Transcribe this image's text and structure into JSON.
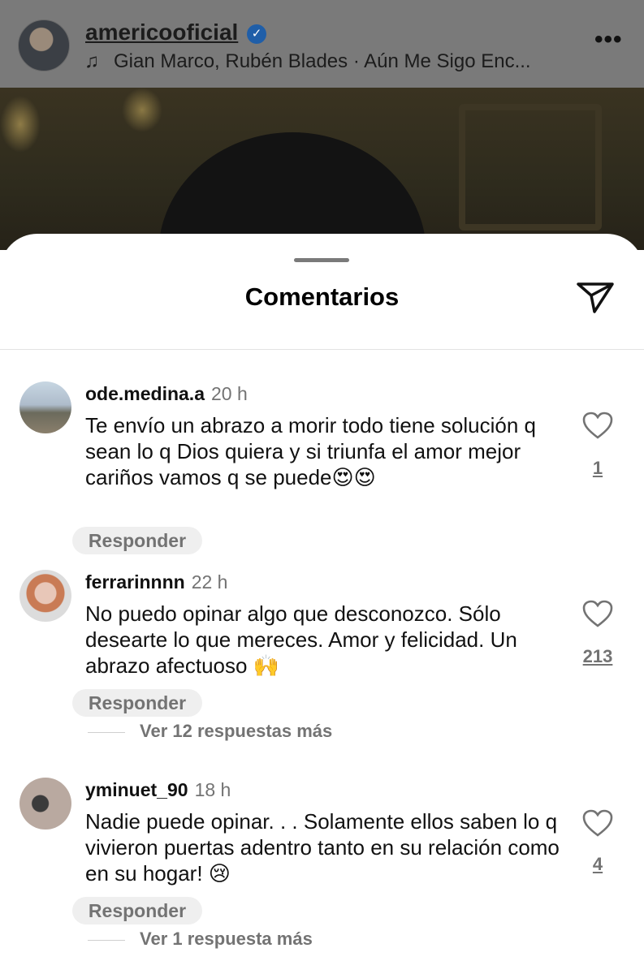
{
  "post_header": {
    "username": "americooficial",
    "verified_mark": "✓",
    "music_icon": "♫",
    "song": "Gian Marco, Rubén Blades · Aún Me Sigo Enc...",
    "more_icon": "•••"
  },
  "sheet": {
    "title": "Comentarios"
  },
  "comments": [
    {
      "username": "ode.medina.a",
      "time": "20 h",
      "text": "Te envío un abrazo a morir todo tiene solución  q sean lo q Dios quiera y si triunfa el amor mejor  cariños vamos q se puede",
      "emoji": "😍😍",
      "likes": "1",
      "reply_label": "Responder"
    },
    {
      "username": "ferrarinnnn",
      "time": "22 h",
      "text": "No puedo opinar algo que desconozco. Sólo desearte lo que mereces. Amor y felicidad. Un abrazo afectuoso",
      "emoji": "🙌",
      "likes": "213",
      "reply_label": "Responder",
      "view_replies": "Ver 12 respuestas más"
    },
    {
      "username": "yminuet_90",
      "time": "18 h",
      "text": "Nadie puede opinar. . . Solamente ellos saben lo q vivieron puertas adentro tanto en su relación como en su hogar!",
      "emoji": "😢",
      "likes": "4",
      "reply_label": "Responder",
      "view_replies": "Ver 1 respuesta más"
    }
  ]
}
